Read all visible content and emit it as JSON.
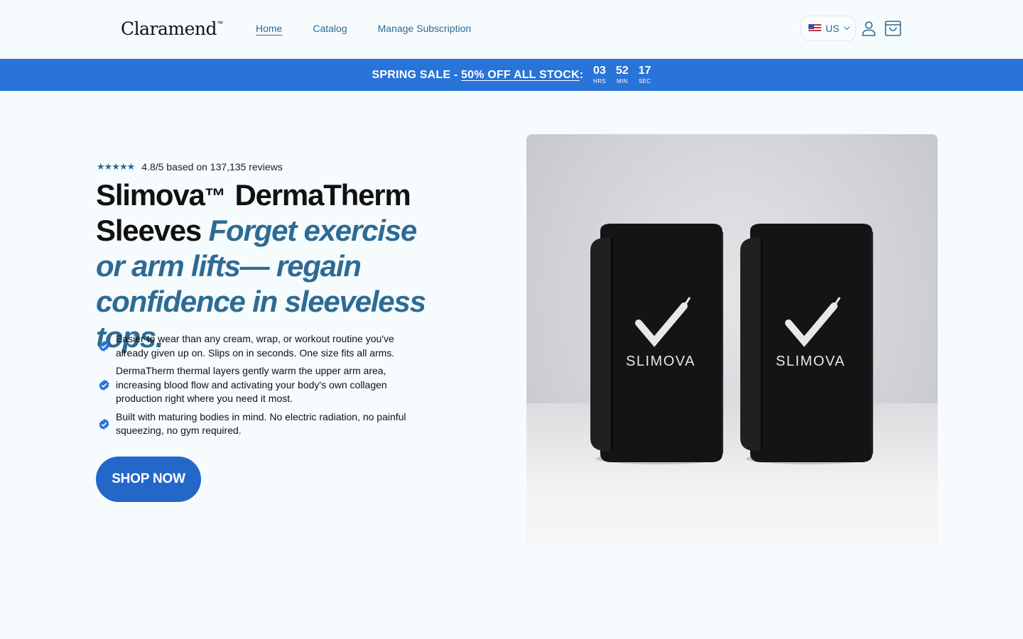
{
  "header": {
    "logo": "Claramend",
    "logo_tm": "™",
    "nav": [
      {
        "label": "Home",
        "active": true
      },
      {
        "label": "Catalog",
        "active": false
      },
      {
        "label": "Manage Subscription",
        "active": false
      }
    ],
    "region": "US",
    "region_icon": "us-flag-icon",
    "account_icon": "user-icon",
    "cart_icon": "cart-icon"
  },
  "sale_bar": {
    "prefix": "SPRING SALE - ",
    "link": "50% OFF ALL STOCK",
    "colon": ":",
    "countdown": [
      {
        "value": "03",
        "label": "HRS"
      },
      {
        "value": "52",
        "label": "MIN"
      },
      {
        "value": "17",
        "label": "SEC"
      }
    ]
  },
  "hero": {
    "stars": "★★★★★",
    "rating": "4.8/5 based on 137,135 reviews",
    "title_brand": "Slimova",
    "title_tm": "™",
    "title_main": "DermaTherm Sleeves",
    "title_tagline": "Forget exercise or arm lifts— regain confidence in sleeveless tops.",
    "benefits": [
      "Easier to wear than any cream, wrap, or workout routine you've already given up on. Slips on in seconds. One size fits all arms.",
      "DermaTherm thermal layers gently warm the upper arm area, increasing blood flow and activating your body's own collagen production right where you need it most.",
      "Built with maturing bodies in mind. No electric radiation, no painful squeezing, no gym required."
    ],
    "cta": "SHOP NOW"
  },
  "product_image": {
    "brand_text": "SLIMOVA"
  },
  "colors": {
    "accent": "#2874d8",
    "button": "#2368c9",
    "link": "#2d6b94",
    "background": "#f6fbfe"
  }
}
